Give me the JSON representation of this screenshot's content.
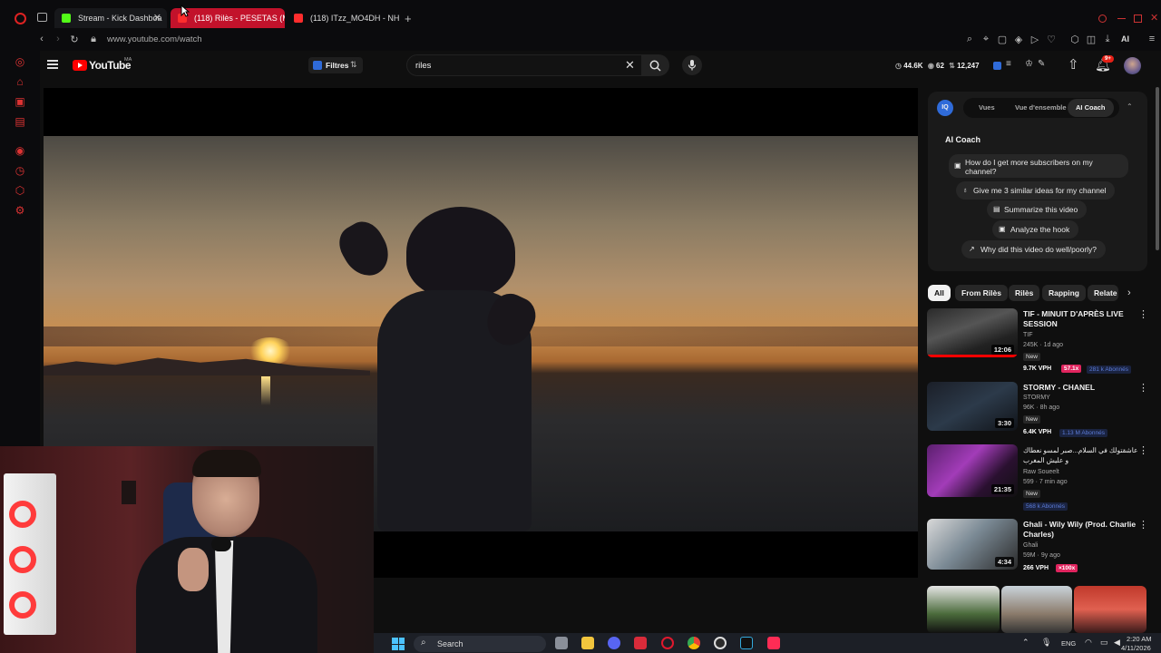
{
  "browser": {
    "tabs": [
      {
        "label": "Stream - Kick Dashboa",
        "close": "✕"
      },
      {
        "label": "(118) Rilès - PESETAS (Mu"
      },
      {
        "label": "(118) ITzz_MO4DH - NHAR"
      }
    ],
    "new_tab": "+",
    "url": "www.youtube.com/watch",
    "ai_label": "AI"
  },
  "youtube": {
    "logo_text": "YouTube",
    "region": "MA",
    "filters_label": "Filtres",
    "search_value": "riles",
    "stats": {
      "views": "44.6K",
      "eyes": "62",
      "count": "12,247"
    },
    "notif_badge": "9+"
  },
  "coach": {
    "tabs": [
      "Vues",
      "Vue d'ensemble",
      "AI Coach"
    ],
    "heading": "AI Coach",
    "prompts": [
      "How do I get more subscribers on my channel?",
      "Give me 3 similar ideas for my channel",
      "Summarize this video",
      "Analyze the hook",
      "Why did this video do well/poorly?"
    ]
  },
  "chips": [
    "All",
    "From Rilès",
    "Rilès",
    "Rapping",
    "Relate"
  ],
  "recommendations": [
    {
      "title": "TIF - MINUIT D'APRÈS LIVE SESSION",
      "channel": "TIF",
      "meta": "245K · 1d ago",
      "badge": "New",
      "duration": "12:06",
      "vph": "9.7K VPH",
      "tag": "57.1x",
      "subs": "281 k Abonnés"
    },
    {
      "title": "STORMY - CHANEL",
      "channel": "STORMY",
      "meta": "96K · 8h ago",
      "badge": "New",
      "duration": "3:30",
      "vph": "6.4K VPH",
      "tag": "",
      "subs": "1.13 M Abonnés"
    },
    {
      "title": "عاشقتولك في السلام...صبر لمسو نعطاك و عليش المغرب",
      "channel": "Raw Soueelt",
      "meta": "599 · 7 min ago",
      "badge": "New",
      "duration": "21:35",
      "vph": "",
      "tag": "",
      "subs": "568 k Abonnés"
    },
    {
      "title": "Ghali - Wily Wily (Prod. Charlie Charles)",
      "channel": "Ghali",
      "meta": "59M · 9y ago",
      "badge": "",
      "duration": "4:34",
      "vph": "266 VPH",
      "tag": "×100x",
      "subs": ""
    }
  ],
  "taskbar": {
    "search_label": "Search",
    "lang": "ENG",
    "time": "2:20 AM",
    "date": "4/11/2026"
  }
}
